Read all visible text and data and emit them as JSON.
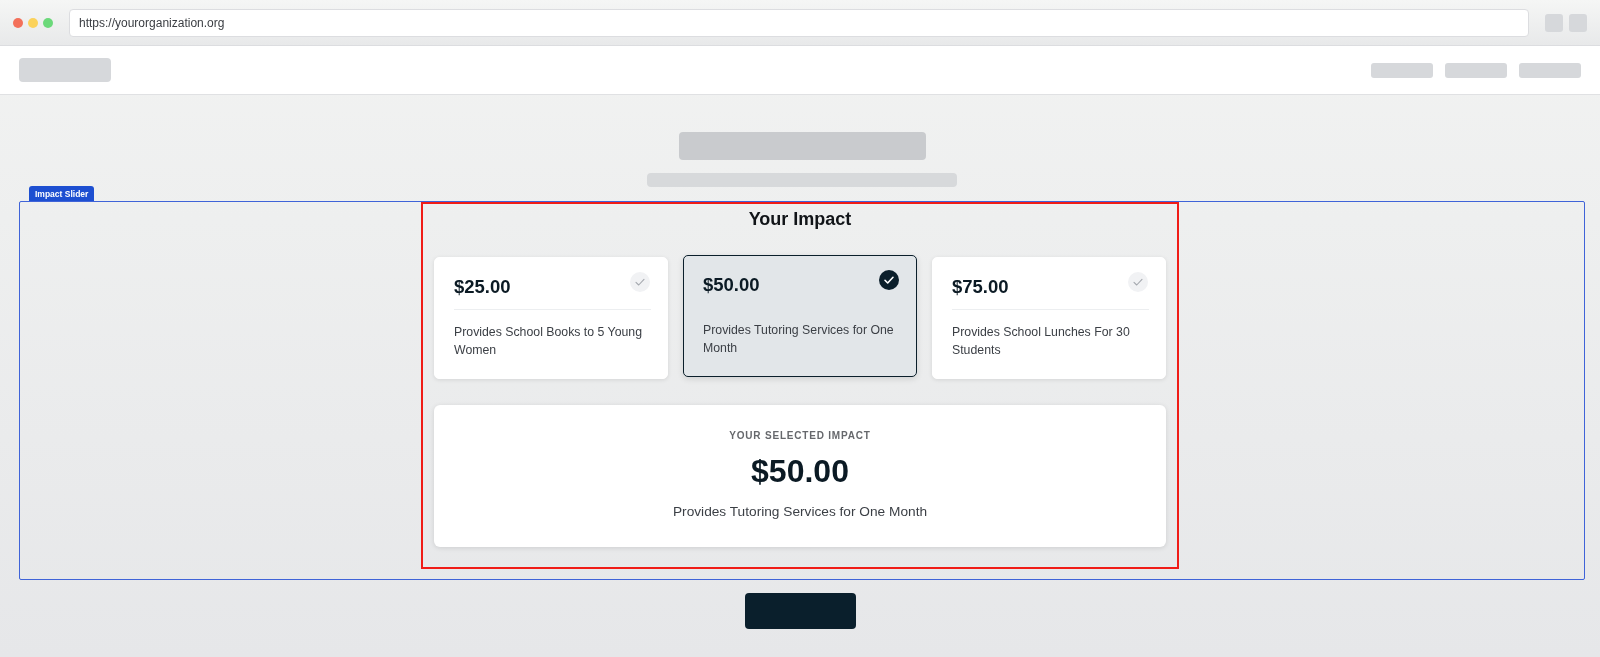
{
  "browser": {
    "url": "https://yourorganization.org"
  },
  "section_label": "Impact Slider",
  "impact": {
    "title": "Your Impact",
    "options": [
      {
        "amount": "$25.00",
        "description": "Provides School Books to 5 Young Women",
        "selected": false
      },
      {
        "amount": "$50.00",
        "description": "Provides Tutoring Services for One Month",
        "selected": true
      },
      {
        "amount": "$75.00",
        "description": "Provides School Lunches For 30 Students",
        "selected": false
      }
    ],
    "summary": {
      "heading": "YOUR SELECTED IMPACT",
      "amount": "$50.00",
      "description": "Provides Tutoring Services for One Month"
    }
  }
}
